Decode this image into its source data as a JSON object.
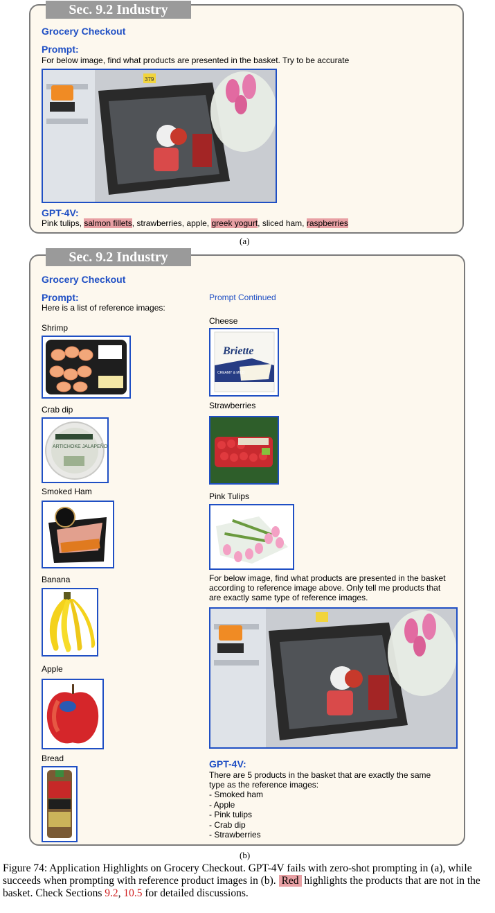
{
  "panel_a": {
    "section_tab": "Sec. 9.2 Industry",
    "title": "Grocery Checkout",
    "prompt_label": "Prompt:",
    "prompt_text": "For below image, find what products are presented in the basket. Try to be accurate",
    "answer_label": "GPT-4V:",
    "answer_items": [
      {
        "text": "Pink tulips",
        "highlight": false
      },
      {
        "text": ", ",
        "highlight": false
      },
      {
        "text": "salmon fillets",
        "highlight": true
      },
      {
        "text": ", strawberries, apple, ",
        "highlight": false
      },
      {
        "text": "greek yogurt",
        "highlight": true
      },
      {
        "text": ", sliced ham, ",
        "highlight": false
      },
      {
        "text": "raspberries",
        "highlight": true
      }
    ],
    "caption": "(a)"
  },
  "panel_b": {
    "section_tab": "Sec. 9.2 Industry",
    "title": "Grocery Checkout",
    "prompt_label": "Prompt:",
    "prompt_text": "Here is a list of reference images:",
    "prompt_continued": "Prompt Continued",
    "left_refs": [
      "Shrimp",
      "Crab dip",
      "Smoked Ham",
      "Banana",
      "Apple",
      "Bread"
    ],
    "right_refs": [
      "Cheese",
      "Strawberries",
      "Pink Tulips"
    ],
    "instruction_lines": [
      "For below image, find what products are presented in the basket",
      "according to reference image above. Only tell me products that",
      "are exactly same type of reference images."
    ],
    "answer_label": "GPT-4V:",
    "answer_lines": [
      "There are 5 products in the basket that are exactly the same",
      "type as the reference images:",
      "- Smoked ham",
      "- Apple",
      "- Pink tulips",
      "- Crab dip",
      "- Strawberries"
    ],
    "caption": "(b)"
  },
  "figure_caption": {
    "part1": "Figure 74: Application Highlights on Grocery Checkout. GPT-4V fails with zero-shot prompting in (a), while succeeds when prompting with reference product images in (b).",
    "red_word": "Red",
    "part2": "highlights the products that are not in the basket. Check Sections",
    "ref1": "9.2",
    "sep": ",",
    "ref2": "10.5",
    "part3": "for detailed discussions."
  },
  "product_labels": {
    "cheese_brand": "Briette",
    "cheese_sub": "CREAMY & MILD",
    "crab_label": "ARTICHOKE JALAPEÑO",
    "price_tag": "379"
  }
}
